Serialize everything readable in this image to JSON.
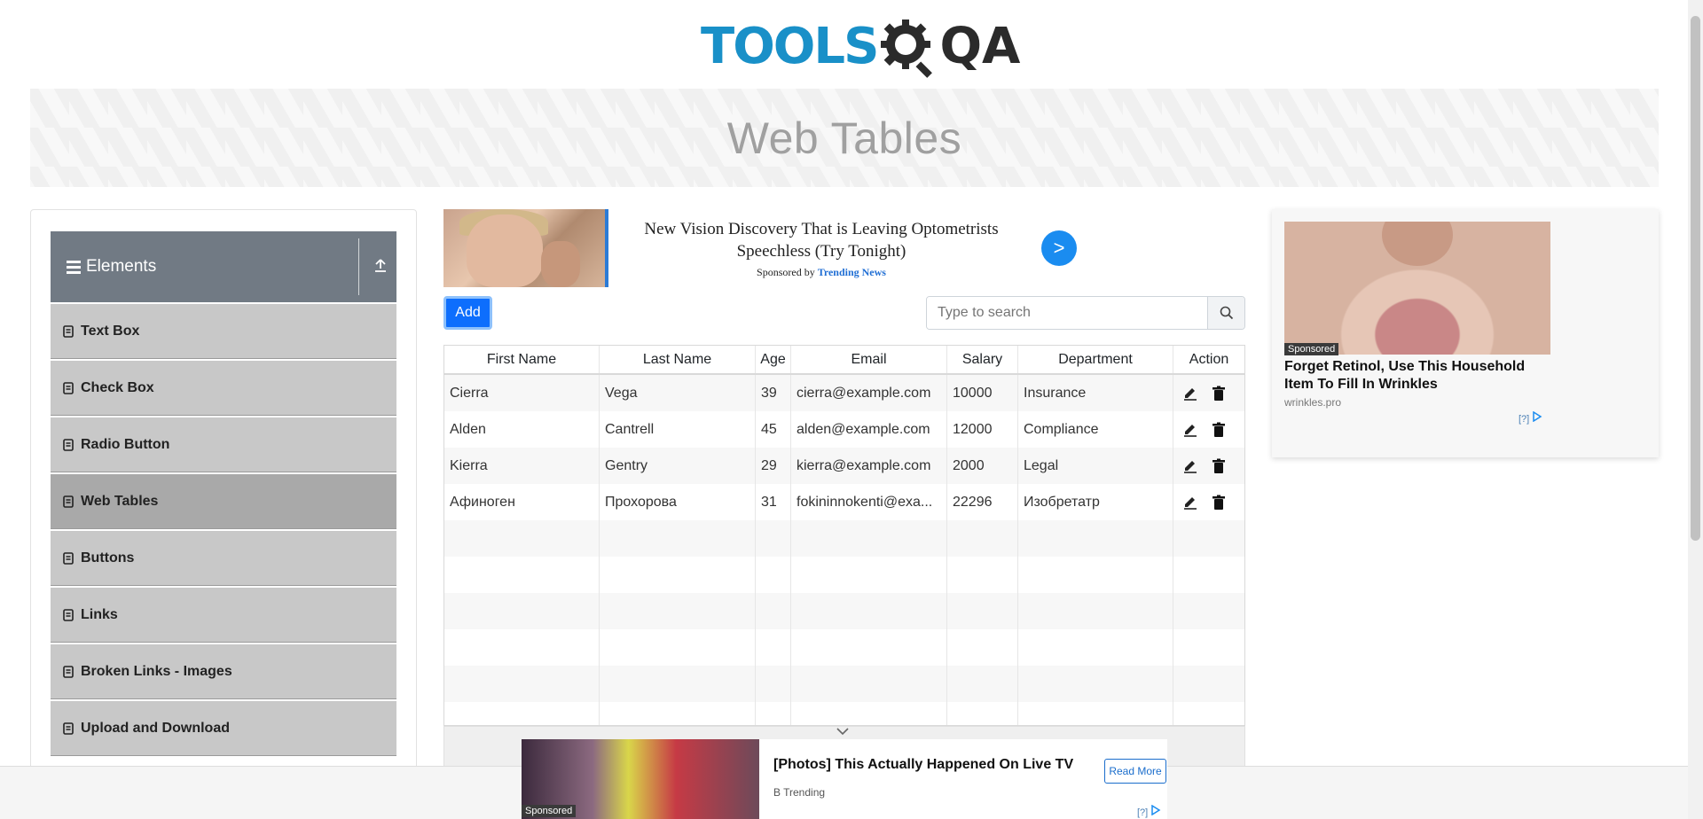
{
  "header": {
    "logo_tools": "TOOLS",
    "logo_qa": "QA"
  },
  "banner": {
    "title": "Web Tables"
  },
  "sidebar": {
    "group_title": "Elements",
    "items": [
      {
        "label": "Text Box"
      },
      {
        "label": "Check Box"
      },
      {
        "label": "Radio Button"
      },
      {
        "label": "Web Tables",
        "active": true
      },
      {
        "label": "Buttons"
      },
      {
        "label": "Links"
      },
      {
        "label": "Broken Links - Images"
      },
      {
        "label": "Upload and Download"
      }
    ]
  },
  "ad_top": {
    "headline": "New Vision Discovery That is Leaving Optometrists Speechless (Try Tonight)",
    "sponsored_by": "Sponsored by",
    "sponsor": "Trending News",
    "go": ">"
  },
  "controls": {
    "add_label": "Add",
    "search_placeholder": "Type to search"
  },
  "table": {
    "columns": [
      "First Name",
      "Last Name",
      "Age",
      "Email",
      "Salary",
      "Department",
      "Action"
    ],
    "rows": [
      [
        "Cierra",
        "Vega",
        "39",
        "cierra@example.com",
        "10000",
        "Insurance"
      ],
      [
        "Alden",
        "Cantrell",
        "45",
        "alden@example.com",
        "12000",
        "Compliance"
      ],
      [
        "Kierra",
        "Gentry",
        "29",
        "kierra@example.com",
        "2000",
        "Legal"
      ],
      [
        "Афиноген",
        "Прохорова",
        "31",
        "fokininnokenti@exa...",
        "22296",
        "Изобретатр"
      ]
    ]
  },
  "ad_right": {
    "tag": "Sponsored",
    "title": "Forget Retinol, Use This Household Item To Fill In Wrinkles",
    "source": "wrinkles.pro",
    "adchoice": "[?]"
  },
  "ad_bottom": {
    "tag": "Sponsored",
    "headline": "[Photos] This Actually Happened On Live TV",
    "source": "B Trending",
    "cta": "Read More",
    "adchoice": "[?]"
  },
  "colors": {
    "brand_blue": "#1990c8",
    "primary": "#0d6efd",
    "sidebar_header": "#717a84"
  }
}
